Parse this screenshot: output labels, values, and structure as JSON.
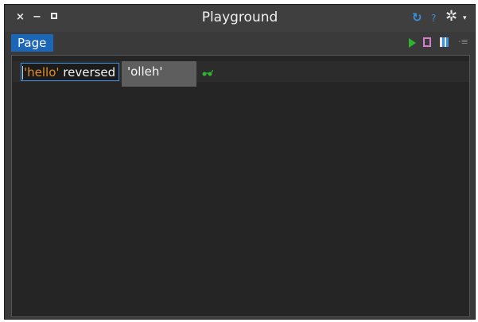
{
  "window": {
    "title": "Playground",
    "controls": {
      "close": "×",
      "minimize": "−",
      "maximize": "□"
    },
    "title_icons": {
      "sync": "↻",
      "help": "?",
      "settings": "✲",
      "settings_menu": "▾"
    }
  },
  "tabs": [
    {
      "label": "Page",
      "active": true
    }
  ],
  "toolbar": {
    "icons": [
      "play-icon",
      "inspect-icon",
      "layout-icon",
      "list-menu-icon"
    ],
    "list_menu_glyph": "·≡"
  },
  "editor": {
    "string_literal": "'hello'",
    "message": " reversed",
    "result": "'olleh'"
  },
  "colors": {
    "accent": "#1c66b8",
    "string": "#e08c2c",
    "play": "#2db52d",
    "result_bg": "#5e5e5e"
  }
}
